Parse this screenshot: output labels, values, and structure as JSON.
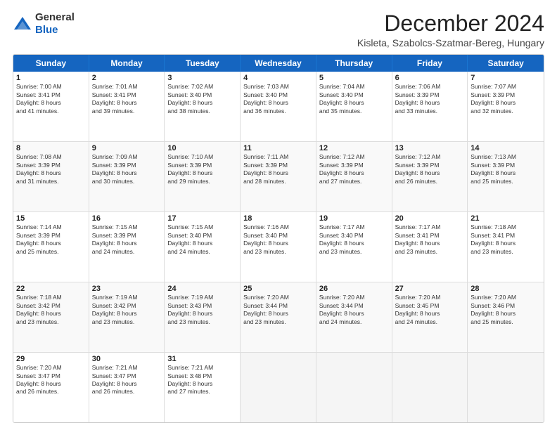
{
  "logo": {
    "line1": "General",
    "line2": "Blue"
  },
  "header": {
    "month": "December 2024",
    "location": "Kisleta, Szabolcs-Szatmar-Bereg, Hungary"
  },
  "days": [
    "Sunday",
    "Monday",
    "Tuesday",
    "Wednesday",
    "Thursday",
    "Friday",
    "Saturday"
  ],
  "rows": [
    [
      {
        "day": "1",
        "lines": [
          "Sunrise: 7:00 AM",
          "Sunset: 3:41 PM",
          "Daylight: 8 hours",
          "and 41 minutes."
        ]
      },
      {
        "day": "2",
        "lines": [
          "Sunrise: 7:01 AM",
          "Sunset: 3:41 PM",
          "Daylight: 8 hours",
          "and 39 minutes."
        ]
      },
      {
        "day": "3",
        "lines": [
          "Sunrise: 7:02 AM",
          "Sunset: 3:40 PM",
          "Daylight: 8 hours",
          "and 38 minutes."
        ]
      },
      {
        "day": "4",
        "lines": [
          "Sunrise: 7:03 AM",
          "Sunset: 3:40 PM",
          "Daylight: 8 hours",
          "and 36 minutes."
        ]
      },
      {
        "day": "5",
        "lines": [
          "Sunrise: 7:04 AM",
          "Sunset: 3:40 PM",
          "Daylight: 8 hours",
          "and 35 minutes."
        ]
      },
      {
        "day": "6",
        "lines": [
          "Sunrise: 7:06 AM",
          "Sunset: 3:39 PM",
          "Daylight: 8 hours",
          "and 33 minutes."
        ]
      },
      {
        "day": "7",
        "lines": [
          "Sunrise: 7:07 AM",
          "Sunset: 3:39 PM",
          "Daylight: 8 hours",
          "and 32 minutes."
        ]
      }
    ],
    [
      {
        "day": "8",
        "lines": [
          "Sunrise: 7:08 AM",
          "Sunset: 3:39 PM",
          "Daylight: 8 hours",
          "and 31 minutes."
        ]
      },
      {
        "day": "9",
        "lines": [
          "Sunrise: 7:09 AM",
          "Sunset: 3:39 PM",
          "Daylight: 8 hours",
          "and 30 minutes."
        ]
      },
      {
        "day": "10",
        "lines": [
          "Sunrise: 7:10 AM",
          "Sunset: 3:39 PM",
          "Daylight: 8 hours",
          "and 29 minutes."
        ]
      },
      {
        "day": "11",
        "lines": [
          "Sunrise: 7:11 AM",
          "Sunset: 3:39 PM",
          "Daylight: 8 hours",
          "and 28 minutes."
        ]
      },
      {
        "day": "12",
        "lines": [
          "Sunrise: 7:12 AM",
          "Sunset: 3:39 PM",
          "Daylight: 8 hours",
          "and 27 minutes."
        ]
      },
      {
        "day": "13",
        "lines": [
          "Sunrise: 7:12 AM",
          "Sunset: 3:39 PM",
          "Daylight: 8 hours",
          "and 26 minutes."
        ]
      },
      {
        "day": "14",
        "lines": [
          "Sunrise: 7:13 AM",
          "Sunset: 3:39 PM",
          "Daylight: 8 hours",
          "and 25 minutes."
        ]
      }
    ],
    [
      {
        "day": "15",
        "lines": [
          "Sunrise: 7:14 AM",
          "Sunset: 3:39 PM",
          "Daylight: 8 hours",
          "and 25 minutes."
        ]
      },
      {
        "day": "16",
        "lines": [
          "Sunrise: 7:15 AM",
          "Sunset: 3:39 PM",
          "Daylight: 8 hours",
          "and 24 minutes."
        ]
      },
      {
        "day": "17",
        "lines": [
          "Sunrise: 7:15 AM",
          "Sunset: 3:40 PM",
          "Daylight: 8 hours",
          "and 24 minutes."
        ]
      },
      {
        "day": "18",
        "lines": [
          "Sunrise: 7:16 AM",
          "Sunset: 3:40 PM",
          "Daylight: 8 hours",
          "and 23 minutes."
        ]
      },
      {
        "day": "19",
        "lines": [
          "Sunrise: 7:17 AM",
          "Sunset: 3:40 PM",
          "Daylight: 8 hours",
          "and 23 minutes."
        ]
      },
      {
        "day": "20",
        "lines": [
          "Sunrise: 7:17 AM",
          "Sunset: 3:41 PM",
          "Daylight: 8 hours",
          "and 23 minutes."
        ]
      },
      {
        "day": "21",
        "lines": [
          "Sunrise: 7:18 AM",
          "Sunset: 3:41 PM",
          "Daylight: 8 hours",
          "and 23 minutes."
        ]
      }
    ],
    [
      {
        "day": "22",
        "lines": [
          "Sunrise: 7:18 AM",
          "Sunset: 3:42 PM",
          "Daylight: 8 hours",
          "and 23 minutes."
        ]
      },
      {
        "day": "23",
        "lines": [
          "Sunrise: 7:19 AM",
          "Sunset: 3:42 PM",
          "Daylight: 8 hours",
          "and 23 minutes."
        ]
      },
      {
        "day": "24",
        "lines": [
          "Sunrise: 7:19 AM",
          "Sunset: 3:43 PM",
          "Daylight: 8 hours",
          "and 23 minutes."
        ]
      },
      {
        "day": "25",
        "lines": [
          "Sunrise: 7:20 AM",
          "Sunset: 3:44 PM",
          "Daylight: 8 hours",
          "and 23 minutes."
        ]
      },
      {
        "day": "26",
        "lines": [
          "Sunrise: 7:20 AM",
          "Sunset: 3:44 PM",
          "Daylight: 8 hours",
          "and 24 minutes."
        ]
      },
      {
        "day": "27",
        "lines": [
          "Sunrise: 7:20 AM",
          "Sunset: 3:45 PM",
          "Daylight: 8 hours",
          "and 24 minutes."
        ]
      },
      {
        "day": "28",
        "lines": [
          "Sunrise: 7:20 AM",
          "Sunset: 3:46 PM",
          "Daylight: 8 hours",
          "and 25 minutes."
        ]
      }
    ],
    [
      {
        "day": "29",
        "lines": [
          "Sunrise: 7:20 AM",
          "Sunset: 3:47 PM",
          "Daylight: 8 hours",
          "and 26 minutes."
        ]
      },
      {
        "day": "30",
        "lines": [
          "Sunrise: 7:21 AM",
          "Sunset: 3:47 PM",
          "Daylight: 8 hours",
          "and 26 minutes."
        ]
      },
      {
        "day": "31",
        "lines": [
          "Sunrise: 7:21 AM",
          "Sunset: 3:48 PM",
          "Daylight: 8 hours",
          "and 27 minutes."
        ]
      },
      null,
      null,
      null,
      null
    ]
  ]
}
